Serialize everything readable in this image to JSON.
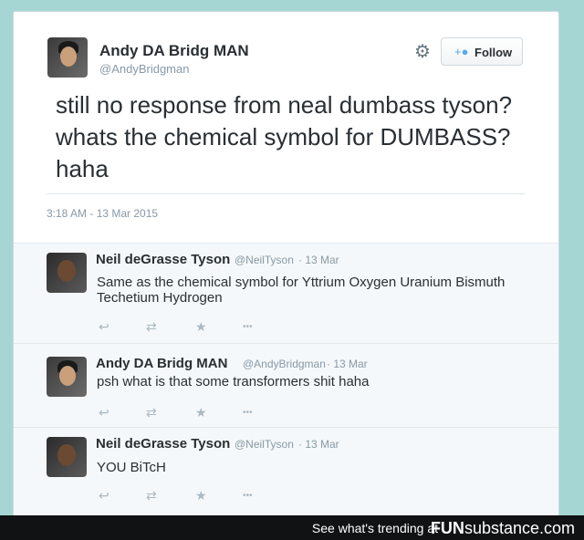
{
  "main_tweet": {
    "author_name": "Andy DA Bridg MAN",
    "author_handle": "@AndyBridgman",
    "follow_label": "Follow",
    "text": "still no response from neal dumbass tyson? whats the chemical symbol for DUMBASS? haha",
    "timestamp": "3:18 AM - 13 Mar 2015",
    "icons": {
      "settings": "gear-icon",
      "follow": "add-user-icon"
    }
  },
  "replies": [
    {
      "name": "Neil deGrasse Tyson",
      "handle": "@NeilTyson",
      "date": "· 13 Mar",
      "text": "Same as the chemical symbol for Yttrium Oxygen Uranium Bismuth Techetium Hydrogen"
    },
    {
      "name": "Andy DA Bridg MAN",
      "handle": "@AndyBridgman",
      "date": "· 13 Mar",
      "text": "psh what is that some transformers shit haha"
    },
    {
      "name": "Neil deGrasse Tyson",
      "handle": "@NeilTyson",
      "date": "· 13 Mar",
      "text": "YOU BiTcH"
    }
  ],
  "action_icons": {
    "reply": "↩",
    "retweet": "⇄",
    "favorite": "★",
    "more": "•••"
  },
  "footer": {
    "trending_text": "See what's trending at",
    "brand_bold": "FUN",
    "brand_rest": "substance.com"
  },
  "colors": {
    "background": "#a5d6d3",
    "accent": "#55acee",
    "muted": "#8899a6"
  }
}
